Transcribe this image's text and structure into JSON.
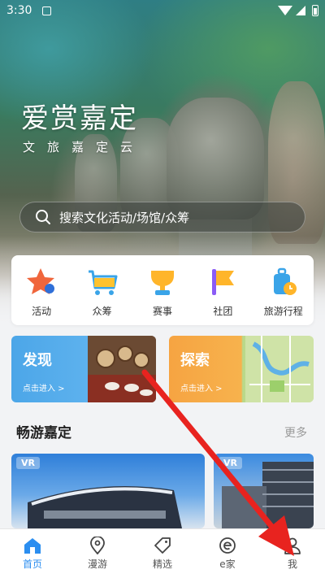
{
  "status_bar": {
    "time": "3:30"
  },
  "hero": {
    "title": "爱赏嘉定",
    "subtitle": "文旅嘉定云"
  },
  "search": {
    "placeholder": "搜索文化活动/场馆/众筹"
  },
  "quick_menu": [
    {
      "label": "活动",
      "icon": "star-icon"
    },
    {
      "label": "众筹",
      "icon": "cart-icon"
    },
    {
      "label": "赛事",
      "icon": "trophy-icon"
    },
    {
      "label": "社团",
      "icon": "flag-icon"
    },
    {
      "label": "旅游行程",
      "icon": "luggage-icon"
    }
  ],
  "cards": [
    {
      "title": "发现",
      "entry": "点击进入 >"
    },
    {
      "title": "探索",
      "entry": "点击进入 >"
    }
  ],
  "section": {
    "title": "畅游嘉定",
    "more": "更多"
  },
  "vr_tiles": [
    {
      "badge": "VR"
    },
    {
      "badge": "VR"
    }
  ],
  "bottom_nav": [
    {
      "label": "首页",
      "icon": "home-icon",
      "active": true
    },
    {
      "label": "漫游",
      "icon": "location-pin-icon"
    },
    {
      "label": "精选",
      "icon": "tag-icon"
    },
    {
      "label": "e家",
      "icon": "e-icon"
    },
    {
      "label": "我",
      "icon": "user-icon"
    }
  ],
  "colors": {
    "accent": "#2b8ef0",
    "annotation_arrow": "#e8231f"
  }
}
